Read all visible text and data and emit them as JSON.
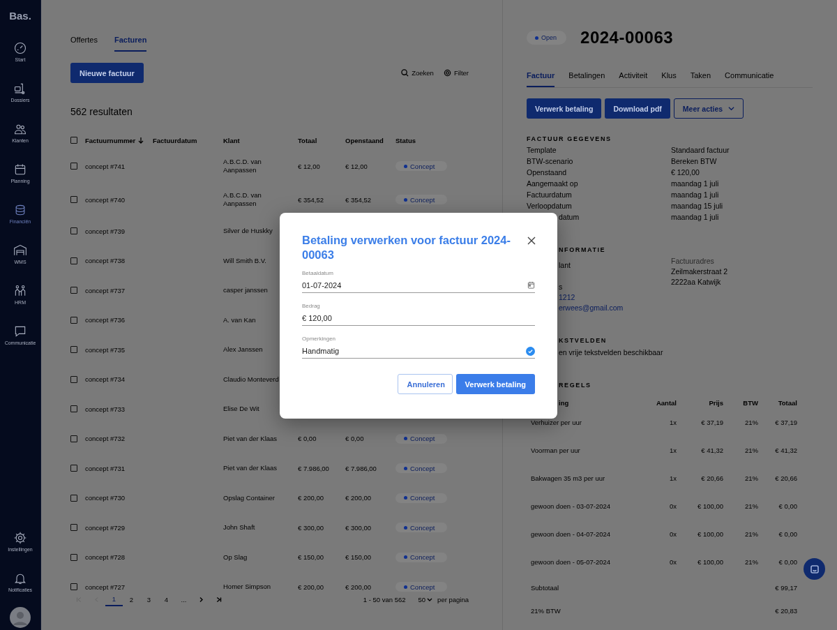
{
  "sidebar": {
    "logo": "Bas.",
    "items": [
      {
        "label": "Start",
        "selected": false
      },
      {
        "label": "Dossiers",
        "selected": false
      },
      {
        "label": "Klanten",
        "selected": false
      },
      {
        "label": "Planning",
        "selected": false
      },
      {
        "label": "Financiën",
        "selected": true
      },
      {
        "label": "WMS",
        "selected": false
      },
      {
        "label": "HRM",
        "selected": false
      },
      {
        "label": "Communicatie",
        "selected": false
      }
    ],
    "bottom_items": [
      {
        "label": "Instellingen",
        "selected": false
      },
      {
        "label": "Notificaties",
        "selected": false
      }
    ]
  },
  "list": {
    "tabs": [
      {
        "label": "Offertes",
        "selected": false
      },
      {
        "label": "Facturen",
        "selected": true
      }
    ],
    "new_button": "Nieuwe factuur",
    "tools": [
      "Zoeken",
      "Filter"
    ],
    "result_count": "562 resultaten",
    "select_all_checked": false,
    "columns": [
      {
        "label": "Factuurnummer",
        "sorted": true
      },
      {
        "label": "Factuurdatum",
        "sorted": false
      },
      {
        "label": "Klant",
        "sorted": false
      },
      {
        "label": "Totaal",
        "sorted": false
      },
      {
        "label": "Openstaand",
        "sorted": false
      },
      {
        "label": "Status",
        "sorted": false
      }
    ],
    "rows": [
      {
        "number": "concept #741",
        "checked": false,
        "client": "A.B.C.D. van Aanpassen",
        "total": "€ 12,00",
        "open": "€ 12,00",
        "status": "Concept"
      },
      {
        "number": "concept #740",
        "checked": false,
        "client": "A.B.C.D. van Aanpassen",
        "total": "€ 354,52",
        "open": "€ 354,52",
        "status": "Concept"
      },
      {
        "number": "concept #739",
        "checked": false,
        "client": "Silver de Huskky"
      },
      {
        "number": "concept #738",
        "checked": false,
        "client": "Will Smith B.V."
      },
      {
        "number": "concept #737",
        "checked": false,
        "client": "casper janssen"
      },
      {
        "number": "concept #736",
        "checked": false,
        "client": "A. van Kan"
      },
      {
        "number": "concept #735",
        "checked": false,
        "client": "Alex Janssen"
      },
      {
        "number": "concept #734",
        "checked": false,
        "client": "Claudio Monteverd"
      },
      {
        "number": "concept #733",
        "checked": false,
        "client": "Elise De Wit"
      },
      {
        "number": "concept #732",
        "checked": false,
        "client": "Piet van der Klaas",
        "total": "€ 0,00",
        "open": "€ 0,00",
        "status": "Concept"
      },
      {
        "number": "concept #731",
        "checked": false,
        "client": "Piet van der Klaas",
        "total": "€ 7.986,00",
        "open": "€ 7.986,00",
        "status": "Concept"
      },
      {
        "number": "concept #730",
        "checked": false,
        "client": "Opslag Container",
        "total": "€ 200,00",
        "open": "€ 200,00",
        "status": "Concept"
      },
      {
        "number": "concept #729",
        "checked": false,
        "client": "John Shaft",
        "total": "€ 300,00",
        "open": "€ 300,00",
        "status": "Concept"
      },
      {
        "number": "concept #728",
        "checked": false,
        "client": "Op Slag",
        "total": "€ 150,00",
        "open": "€ 150,00",
        "status": "Concept"
      },
      {
        "number": "concept #727",
        "checked": false,
        "client": "Homer Simpson",
        "total": "€ 200,00",
        "open": "€ 200,00",
        "status": "Concept"
      }
    ],
    "pagination": {
      "nav": [
        {
          "kind": "first",
          "disabled": true
        },
        {
          "kind": "prev",
          "disabled": true
        },
        {
          "kind": "next",
          "disabled": false
        },
        {
          "kind": "last",
          "disabled": false
        }
      ],
      "pages": [
        {
          "label": "1",
          "selected": true
        },
        {
          "label": "2",
          "selected": false
        },
        {
          "label": "3",
          "selected": false
        },
        {
          "label": "4",
          "selected": false
        },
        {
          "label": "...",
          "selected": false
        }
      ],
      "range": "1 - 50 van 562",
      "per_page": "50",
      "per_page_label": "per pagina"
    }
  },
  "detail": {
    "status": "Open",
    "title": "2024-00063",
    "tabs": [
      {
        "label": "Factuur",
        "selected": true
      },
      {
        "label": "Betalingen",
        "selected": false
      },
      {
        "label": "Activiteit",
        "selected": false
      },
      {
        "label": "Klus",
        "selected": false
      },
      {
        "label": "Taken",
        "selected": false
      },
      {
        "label": "Communicatie",
        "selected": false
      }
    ],
    "actions": [
      {
        "label": "Verwerk betaling",
        "kind": "primary"
      },
      {
        "label": "Download pdf",
        "kind": "primary"
      },
      {
        "label": "Meer acties",
        "kind": "dropdown"
      }
    ],
    "invoice": {
      "heading": "FACTUUR GEGEVENS",
      "rows": [
        {
          "label": "Template",
          "value": "Standaard factuur"
        },
        {
          "label": "BTW-scenario",
          "value": "Bereken BTW"
        },
        {
          "label": "Openstaand",
          "value": "€ 120,00"
        },
        {
          "label": "Aangemaakt op",
          "value": "maandag 1 juli"
        },
        {
          "label": "Factuurdatum",
          "value": "maandag 1 juli"
        },
        {
          "label": "Verloopdatum",
          "value": "maandag 15 juli"
        },
        {
          "label": "datum",
          "value": "maandag 1 juli"
        }
      ]
    },
    "customer": {
      "heading": "NFORMATIE",
      "left": [
        {
          "text": "lant",
          "kind": "plain"
        },
        {
          "text": "s",
          "kind": "plain"
        },
        {
          "text": "1212",
          "kind": "link"
        },
        {
          "text": "erwees@gmail.com",
          "kind": "link"
        }
      ],
      "right": [
        {
          "text": "Factuuradres",
          "kind": "muted"
        },
        {
          "text": "Zeilmakerstraat 2",
          "kind": "plain"
        },
        {
          "text": "2222aa Katwijk",
          "kind": "plain"
        }
      ]
    },
    "text_fields": {
      "heading": "KSTVELDEN",
      "text": "en vrije tekstvelden beschikbaar"
    },
    "lines": {
      "heading": "REGELS",
      "columns": [
        "ing",
        "Aantal",
        "Prijs",
        "BTW",
        "Totaal"
      ],
      "rows": [
        [
          "Verhuizer per uur",
          "1x",
          "€ 37,19",
          "21%",
          "€ 37,19"
        ],
        [
          "Voorman per uur",
          "1x",
          "€ 41,32",
          "21%",
          "€ 41,32"
        ],
        [
          "Bakwagen 35 m3 per uur",
          "1x",
          "€ 20,66",
          "21%",
          "€ 20,66"
        ],
        [
          "gewoon doen - 03-07-2024",
          "0x",
          "€ 100,00",
          "21%",
          "€ 0,00"
        ],
        [
          "gewoon doen - 04-07-2024",
          "0x",
          "€ 100,00",
          "21%",
          "€ 0,00"
        ],
        [
          "gewoon doen - 05-07-2024",
          "0x",
          "€ 100,00",
          "21%",
          "€ 0,00"
        ]
      ],
      "summary": [
        {
          "label": "Subtotaal",
          "value": "€ 99,17"
        },
        {
          "label": "21% BTW",
          "value": "€ 20,83"
        }
      ]
    }
  },
  "dialog": {
    "title": "Betaling verwerken voor factuur 2024-00063",
    "fields": [
      {
        "label": "Betaaldatum",
        "value": "01-07-2024",
        "kind": "date"
      },
      {
        "label": "Bedrag",
        "value": "€ 120,00",
        "kind": "text"
      },
      {
        "label": "Opmerkingen",
        "value": "Handmatig",
        "kind": "valid"
      }
    ],
    "buttons": [
      {
        "label": "Annuleren",
        "kind": "secondary"
      },
      {
        "label": "Verwerk betaling",
        "kind": "primary"
      }
    ]
  }
}
